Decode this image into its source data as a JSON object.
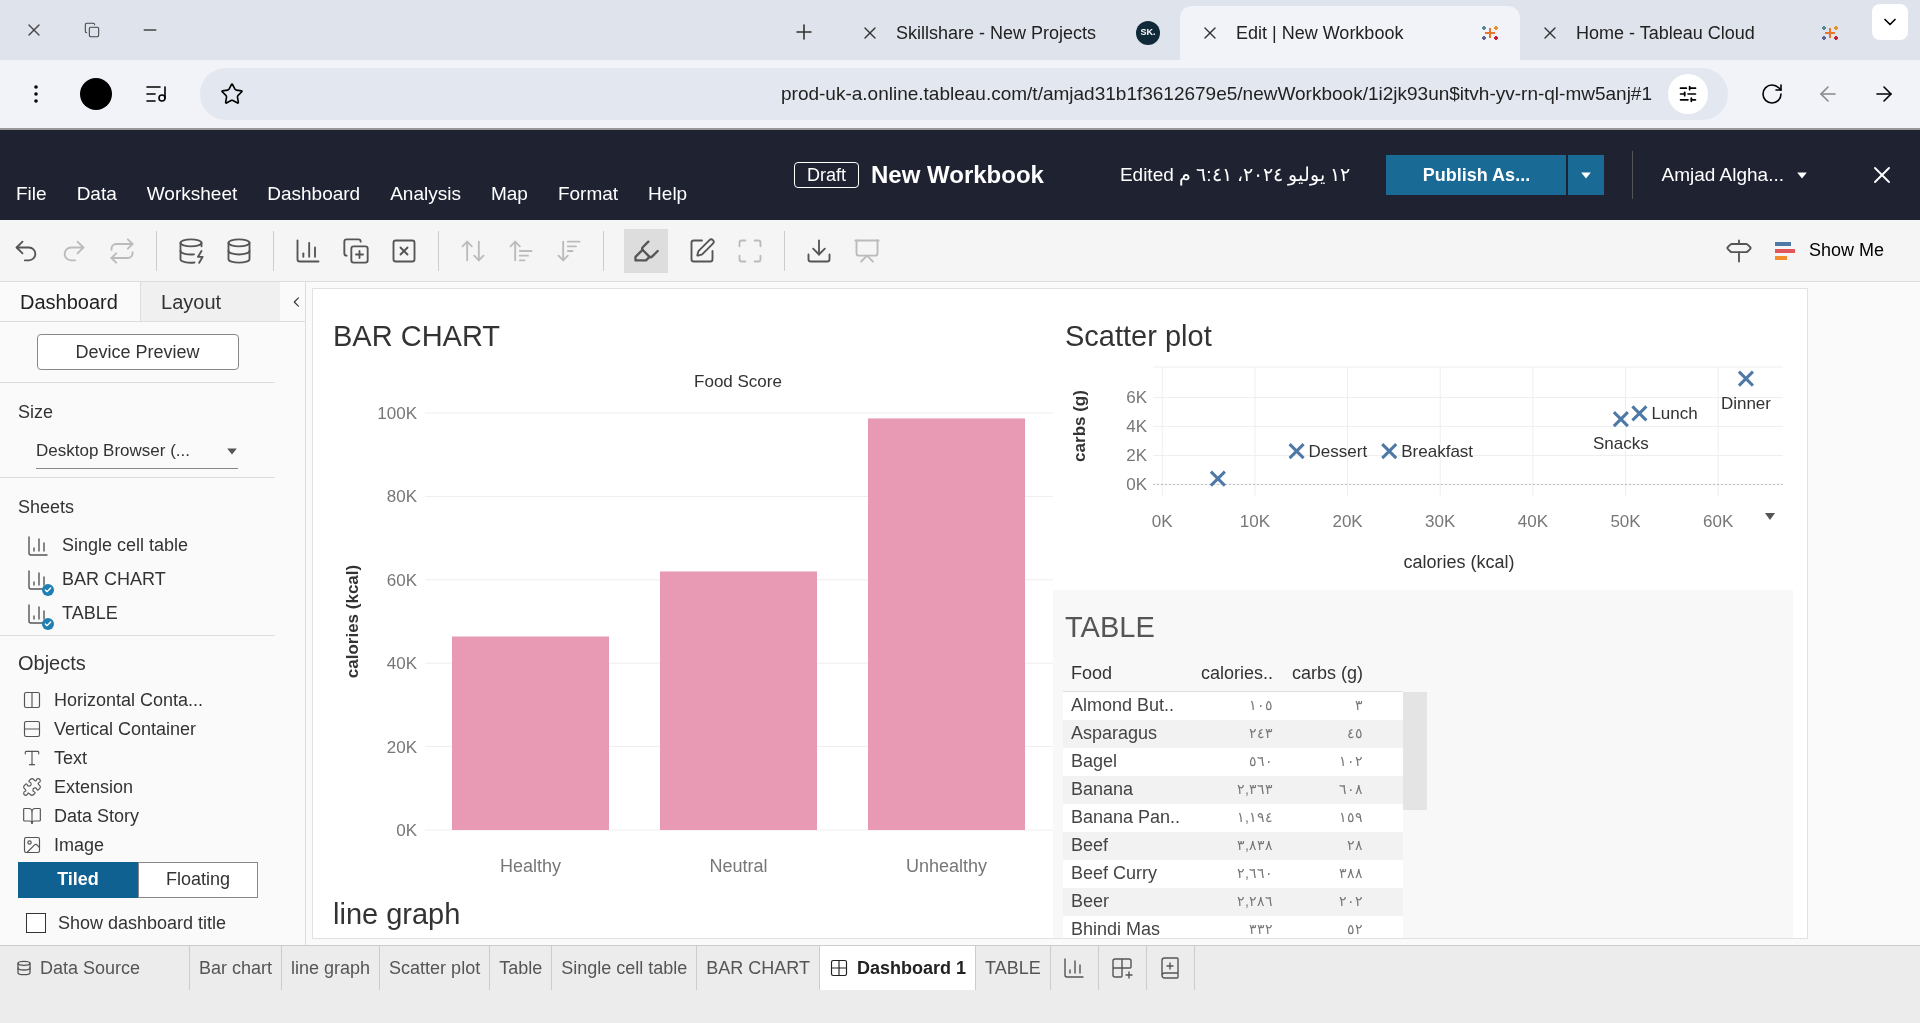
{
  "browser": {
    "tabs": [
      {
        "title": "Skillshare - New Projects",
        "badge": "SK.",
        "kind": "site",
        "selected": false
      },
      {
        "title": "Edit | New Workbook",
        "kind": "tableau",
        "selected": true
      },
      {
        "title": "Home - Tableau Cloud",
        "kind": "tableau",
        "selected": false
      }
    ],
    "url": "prod-uk-a.online.tableau.com/t/amjad31b1f3612679e5/newWorkbook/1i2jk93un$itvh-yv-rn-ql-mw5anj#1"
  },
  "app": {
    "menu": [
      "File",
      "Data",
      "Worksheet",
      "Dashboard",
      "Analysis",
      "Map",
      "Format",
      "Help"
    ],
    "badge": "Draft",
    "title": "New Workbook",
    "edited": "Edited ١٢ يوليو ٢٠٢٤، ٦:٤١ م",
    "publish": "Publish As...",
    "user": "Amjad Algha...",
    "show_me": "Show Me"
  },
  "side": {
    "tabs": [
      {
        "label": "Dashboard",
        "selected": true
      },
      {
        "label": "Layout",
        "selected": false
      }
    ],
    "device_preview": "Device Preview",
    "size_label": "Size",
    "size_value": "Desktop Browser (...",
    "sheets_label": "Sheets",
    "sheets": [
      {
        "label": "Single cell table",
        "checked": false
      },
      {
        "label": "BAR CHART",
        "checked": true
      },
      {
        "label": "TABLE",
        "checked": true
      }
    ],
    "objects_label": "Objects",
    "objects": [
      {
        "label": "Horizontal Conta...",
        "kind": "horizontal"
      },
      {
        "label": "Vertical Container",
        "kind": "vertical"
      },
      {
        "label": "Text",
        "kind": "text"
      },
      {
        "label": "Extension",
        "kind": "extension"
      },
      {
        "label": "Data Story",
        "kind": "story"
      },
      {
        "label": "Image",
        "kind": "image"
      }
    ],
    "layout_modes": [
      {
        "label": "Tiled",
        "selected": true
      },
      {
        "label": "Floating",
        "selected": false
      }
    ],
    "show_title": {
      "label": "Show dashboard title",
      "checked": false
    }
  },
  "bar": {
    "title": "BAR CHART",
    "chart_data": {
      "type": "bar",
      "title": "Food Score",
      "grid": true,
      "categories": [
        "Healthy",
        "Neutral",
        "Unhealthy"
      ],
      "series": [
        {
          "name": "calories (kcal)",
          "color": "#e89ab5",
          "values": [
            46400,
            62000,
            98700
          ]
        }
      ],
      "ylim": [
        0,
        100000
      ],
      "yticks": [
        {
          "value": 0,
          "label": "0K"
        },
        {
          "value": 20000,
          "label": "20K"
        },
        {
          "value": 40000,
          "label": "40K"
        },
        {
          "value": 60000,
          "label": "60K"
        },
        {
          "value": 80000,
          "label": "80K"
        },
        {
          "value": 100000,
          "label": "100K"
        }
      ]
    }
  },
  "line_title": "line graph",
  "scatter": {
    "title": "Scatter plot",
    "chart_data": {
      "type": "scatter",
      "xlabel": "calories (kcal)",
      "grid": true,
      "xlim": [
        -1000,
        67000
      ],
      "ylim": [
        -800,
        8100
      ],
      "ref_lines": [
        {
          "axis": "y",
          "value": 0
        }
      ],
      "x": [
        6000,
        14500,
        24500,
        49500,
        51500,
        63000
      ],
      "series": [
        {
          "name": "carbs (g)",
          "color": "#4e79a7",
          "values": [
            400,
            2300,
            2300,
            4500,
            4900,
            7300
          ]
        }
      ],
      "xticks": [
        {
          "value": 0,
          "label": "0K"
        },
        {
          "value": 10000,
          "label": "10K"
        },
        {
          "value": 20000,
          "label": "20K"
        },
        {
          "value": 30000,
          "label": "30K"
        },
        {
          "value": 40000,
          "label": "40K"
        },
        {
          "value": 50000,
          "label": "50K"
        },
        {
          "value": 60000,
          "label": "60K"
        }
      ],
      "yticks": [
        {
          "value": 0,
          "label": "0K"
        },
        {
          "value": 2000,
          "label": "2K"
        },
        {
          "value": 4000,
          "label": "4K"
        },
        {
          "value": 6000,
          "label": "6K"
        }
      ],
      "annotations": [
        {
          "x": 14500,
          "y": 2300,
          "text": "Dessert"
        },
        {
          "x": 24500,
          "y": 2300,
          "text": "Breakfast"
        },
        {
          "x": 49500,
          "y": 4500,
          "text": "Snacks"
        },
        {
          "x": 51500,
          "y": 4900,
          "text": "Lunch"
        },
        {
          "x": 63000,
          "y": 7300,
          "text": "Dinner"
        }
      ]
    }
  },
  "table": {
    "title": "TABLE",
    "columns": [
      "Food",
      "calories..",
      "carbs (g)"
    ],
    "rows": [
      [
        "Almond But..",
        "١٠٥",
        "٣"
      ],
      [
        "Asparagus",
        "٢٤٣",
        "٤٥"
      ],
      [
        "Bagel",
        "٥٦٠",
        "١٠٢"
      ],
      [
        "Banana",
        "٢,٣٦٣",
        "٦٠٨"
      ],
      [
        "Banana Pan..",
        "١,١٩٤",
        "١٥٩"
      ],
      [
        "Beef",
        "٣,٨٣٨",
        "٢٨"
      ],
      [
        "Beef Curry",
        "٢,٦٦٠",
        "٣٨٨"
      ],
      [
        "Beer",
        "٢,٢٨٦",
        "٢٠٢"
      ],
      [
        "Bhindi Mas",
        "٣٣٢",
        "٥٢"
      ]
    ]
  },
  "bottom": {
    "data_source": "Data Source",
    "tabs": [
      {
        "label": "Bar chart",
        "kind": "sheet",
        "selected": false
      },
      {
        "label": "line graph",
        "kind": "sheet",
        "selected": false
      },
      {
        "label": "Scatter plot",
        "kind": "sheet",
        "selected": false
      },
      {
        "label": "Table",
        "kind": "sheet",
        "selected": false
      },
      {
        "label": "Single cell table",
        "kind": "sheet",
        "selected": false
      },
      {
        "label": "BAR CHART",
        "kind": "sheet",
        "selected": false
      },
      {
        "label": "Dashboard 1",
        "kind": "dashboard",
        "selected": true
      },
      {
        "label": "TABLE",
        "kind": "sheet",
        "selected": false
      }
    ]
  }
}
